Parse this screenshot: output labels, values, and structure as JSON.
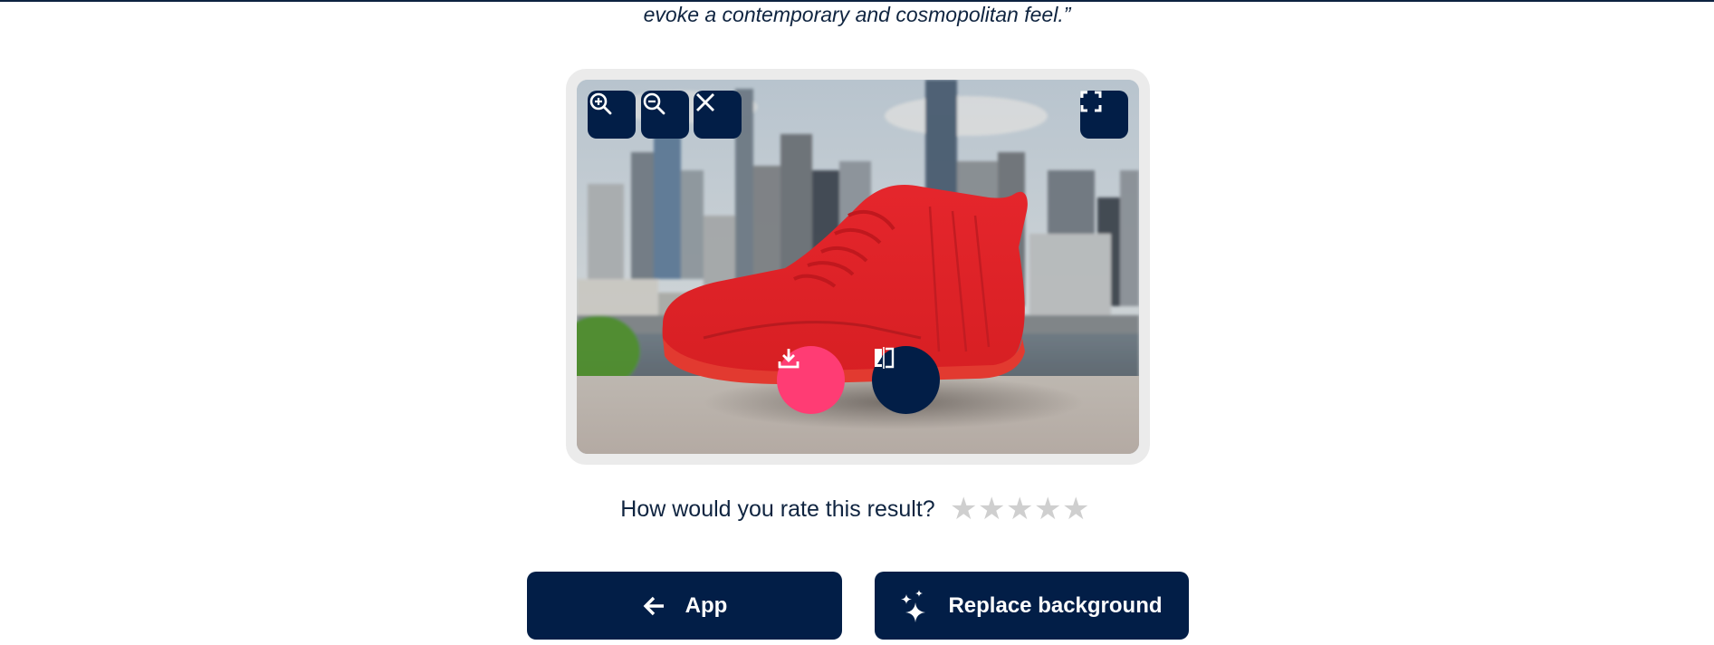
{
  "quote_fragment": "evoke a contemporary and cosmopolitan feel.”",
  "image_viewer": {
    "image_description": "Red high-top sneaker on a concrete ledge in front of a blurred city skyline",
    "toolbar": [
      {
        "name": "zoom-in",
        "icon": "zoom-in-icon"
      },
      {
        "name": "zoom-out",
        "icon": "zoom-out-icon"
      },
      {
        "name": "close",
        "icon": "close-icon"
      }
    ],
    "fullscreen_icon": "fullscreen-icon",
    "overlay_actions": [
      {
        "name": "download",
        "icon": "download-icon",
        "color": "#ff3c74"
      },
      {
        "name": "compare",
        "icon": "compare-icon",
        "color": "#021e47"
      }
    ]
  },
  "rating": {
    "question": "How would you rate this result?",
    "max_stars": 5,
    "selected": 0,
    "star_glyph": "★"
  },
  "actions": {
    "back_label": "App",
    "replace_label": "Replace background"
  },
  "colors": {
    "primary": "#021e47",
    "accent": "#ff3c74",
    "star_inactive": "#cfcfcf"
  }
}
